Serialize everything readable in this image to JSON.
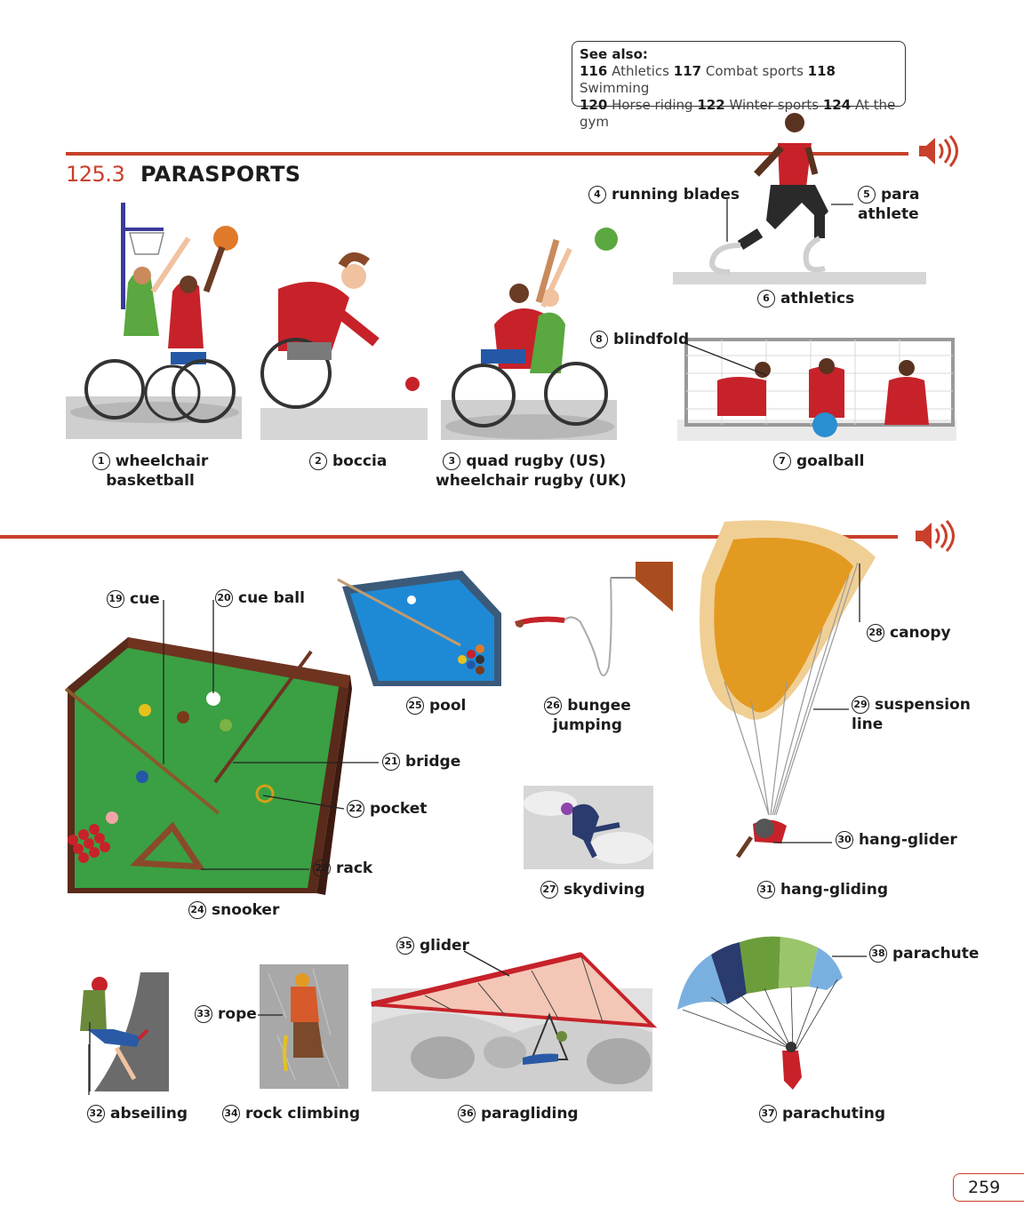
{
  "see_also": {
    "title": "See also:",
    "line1": [
      {
        "num": "116",
        "text": "Athletics"
      },
      {
        "num": "117",
        "text": "Combat sports"
      },
      {
        "num": "118",
        "text": "Swimming"
      }
    ],
    "line2": [
      {
        "num": "120",
        "text": "Horse riding"
      },
      {
        "num": "122",
        "text": "Winter sports"
      },
      {
        "num": "124",
        "text": "At the gym"
      }
    ]
  },
  "section": {
    "number": "125.3",
    "title": "PARASPORTS"
  },
  "labels": {
    "l1": {
      "n": "1",
      "a": "wheelchair",
      "b": "basketball"
    },
    "l2": {
      "n": "2",
      "a": "boccia"
    },
    "l3": {
      "n": "3",
      "a": "quad rugby (US)",
      "b": "wheelchair rugby (UK)"
    },
    "l4": {
      "n": "4",
      "a": "running blades"
    },
    "l5": {
      "n": "5",
      "a": "para",
      "b": "athlete"
    },
    "l6": {
      "n": "6",
      "a": "athletics"
    },
    "l7": {
      "n": "7",
      "a": "goalball"
    },
    "l8": {
      "n": "8",
      "a": "blindfold"
    },
    "l19": {
      "n": "19",
      "a": "cue"
    },
    "l20": {
      "n": "20",
      "a": "cue ball"
    },
    "l21": {
      "n": "21",
      "a": "bridge"
    },
    "l22": {
      "n": "22",
      "a": "pocket"
    },
    "l23": {
      "n": "23",
      "a": "rack"
    },
    "l24": {
      "n": "24",
      "a": "snooker"
    },
    "l25": {
      "n": "25",
      "a": "pool"
    },
    "l26": {
      "n": "26",
      "a": "bungee",
      "b": "jumping"
    },
    "l27": {
      "n": "27",
      "a": "skydiving"
    },
    "l28": {
      "n": "28",
      "a": "canopy"
    },
    "l29": {
      "n": "29",
      "a": "suspension",
      "b": "line"
    },
    "l30": {
      "n": "30",
      "a": "hang-glider"
    },
    "l31": {
      "n": "31",
      "a": "hang-gliding"
    },
    "l32": {
      "n": "32",
      "a": "abseiling"
    },
    "l33": {
      "n": "33",
      "a": "rope"
    },
    "l34": {
      "n": "34",
      "a": "rock climbing"
    },
    "l35": {
      "n": "35",
      "a": "glider"
    },
    "l36": {
      "n": "36",
      "a": "paragliding"
    },
    "l37": {
      "n": "37",
      "a": "parachuting"
    },
    "l38": {
      "n": "38",
      "a": "parachute"
    }
  },
  "page_number": "259",
  "icons": {
    "audio": "speaker-icon"
  },
  "colors": {
    "accent": "#c8402b"
  }
}
